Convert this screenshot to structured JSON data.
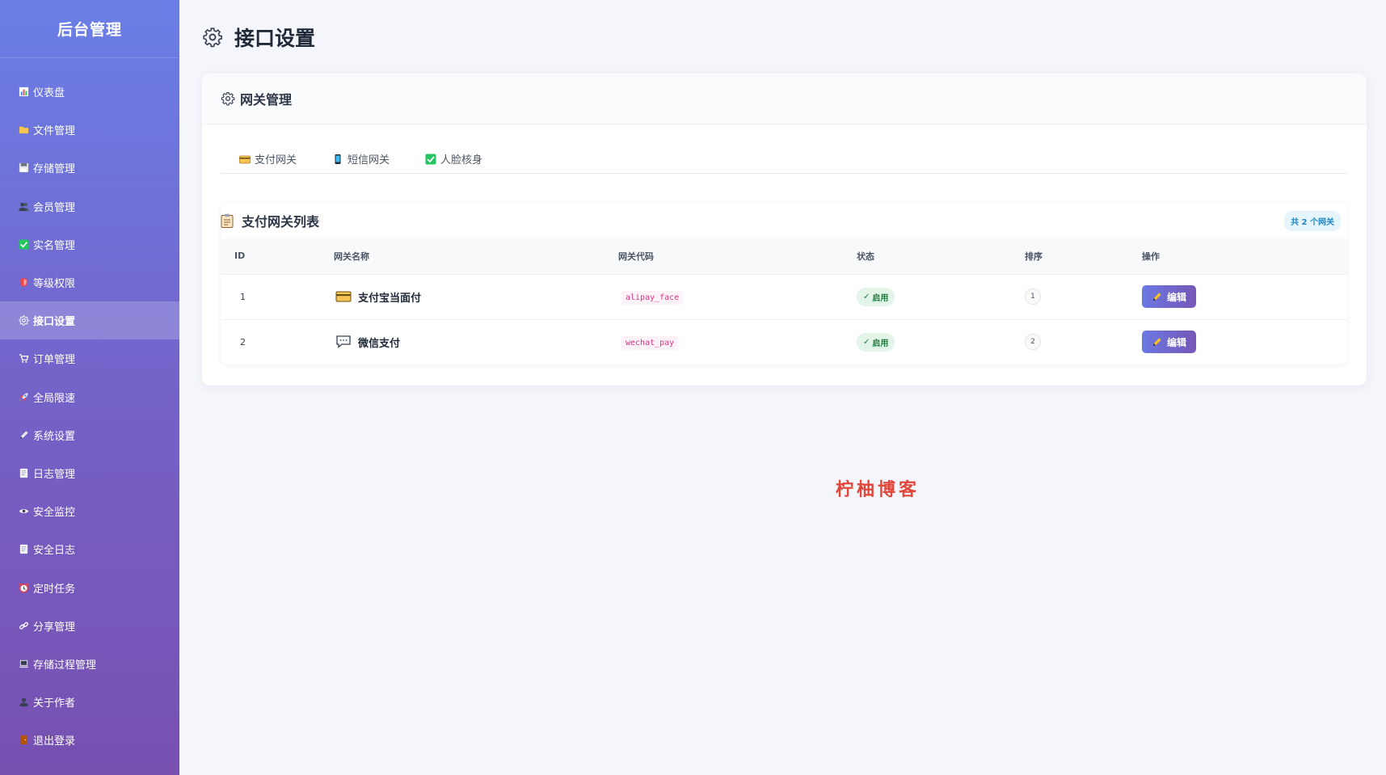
{
  "sidebar": {
    "title": "后台管理",
    "items": [
      {
        "label": "仪表盘",
        "icon": "chart-icon"
      },
      {
        "label": "文件管理",
        "icon": "folder-icon"
      },
      {
        "label": "存储管理",
        "icon": "disk-icon"
      },
      {
        "label": "会员管理",
        "icon": "users-icon"
      },
      {
        "label": "实名管理",
        "icon": "check-icon"
      },
      {
        "label": "等级权限",
        "icon": "shield-icon"
      },
      {
        "label": "接口设置",
        "icon": "gear-icon",
        "active": true
      },
      {
        "label": "订单管理",
        "icon": "cart-icon"
      },
      {
        "label": "全局限速",
        "icon": "rocket-icon"
      },
      {
        "label": "系统设置",
        "icon": "pencil-icon"
      },
      {
        "label": "日志管理",
        "icon": "document-icon"
      },
      {
        "label": "安全监控",
        "icon": "eye-icon"
      },
      {
        "label": "安全日志",
        "icon": "document-icon"
      },
      {
        "label": "定时任务",
        "icon": "alarm-icon"
      },
      {
        "label": "分享管理",
        "icon": "link-icon"
      },
      {
        "label": "存储过程管理",
        "icon": "laptop-icon"
      },
      {
        "label": "关于作者",
        "icon": "user-icon"
      },
      {
        "label": "退出登录",
        "icon": "door-icon"
      }
    ]
  },
  "page": {
    "title": "接口设置"
  },
  "card": {
    "title": "网关管理",
    "tabs": [
      {
        "label": "支付网关",
        "icon": "credit-card-icon"
      },
      {
        "label": "短信网关",
        "icon": "phone-icon"
      },
      {
        "label": "人脸核身",
        "icon": "check-icon"
      }
    ]
  },
  "list": {
    "title": "支付网关列表",
    "count_badge": "共 2 个网关",
    "columns": [
      "ID",
      "网关名称",
      "网关代码",
      "状态",
      "排序",
      "操作"
    ],
    "rows": [
      {
        "id": "1",
        "name": "支付宝当面付",
        "icon": "credit-card-icon",
        "code": "alipay_face",
        "status": "启用",
        "order": "1",
        "action": "编辑"
      },
      {
        "id": "2",
        "name": "微信支付",
        "icon": "chat-bubble-icon",
        "code": "wechat_pay",
        "status": "启用",
        "order": "2",
        "action": "编辑"
      }
    ]
  },
  "watermark": "柠柚博客",
  "colors": {
    "accent": "#6b79e2",
    "accent_end": "#7656b8",
    "status_green": "#1e7a3c",
    "code_pink": "#d63384",
    "watermark_red": "#e0463a"
  }
}
